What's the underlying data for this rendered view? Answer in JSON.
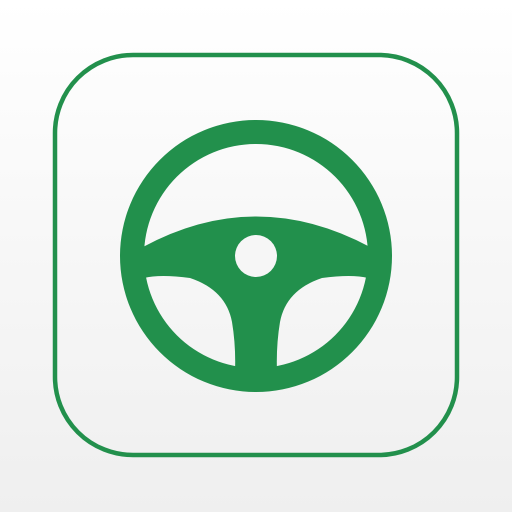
{
  "app_icon": {
    "icon": "steering-wheel-icon",
    "accent_color": "#22904c",
    "background_color": "#f5f5f5"
  }
}
